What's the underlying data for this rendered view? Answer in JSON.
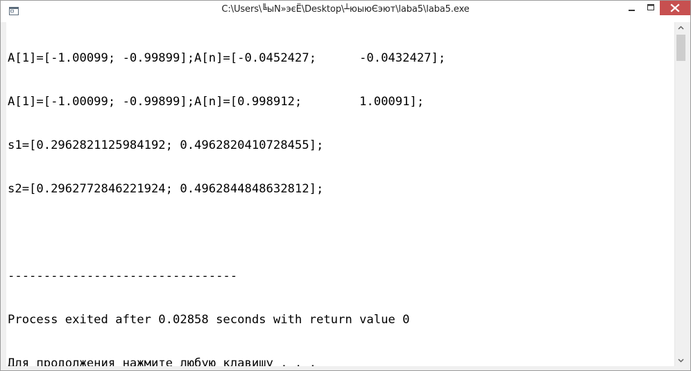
{
  "window": {
    "title": "C:\\Users\\╚ыN»эєЁ\\Desktop\\┴юыюЄэют\\laba5\\laba5.exe"
  },
  "icons": {
    "app": "console-app-icon",
    "minimize": "minimize-icon",
    "maximize": "maximize-icon",
    "close": "close-icon",
    "scroll_up": "chevron-up-icon",
    "scroll_down": "chevron-down-icon"
  },
  "colors": {
    "close_button": "#c75050",
    "console_background": "#ffffff",
    "console_text": "#000000"
  },
  "console": {
    "lines": [
      "A[1]=[-1.00099; -0.99899];A[n]=[-0.0452427;      -0.0432427];",
      "A[1]=[-1.00099; -0.99899];A[n]=[0.998912;        1.00091];",
      "s1=[0.2962821125984192; 0.4962820410728455];",
      "s2=[0.2962772846221924; 0.4962844848632812];",
      "",
      "--------------------------------",
      "Process exited after 0.02858 seconds with return value 0",
      "Для продолжения нажмите любую клавишу . . ."
    ]
  }
}
